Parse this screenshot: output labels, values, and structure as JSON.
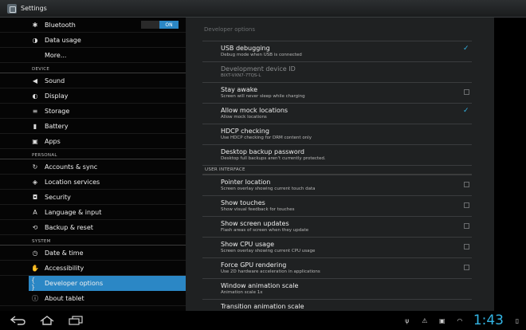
{
  "window": {
    "title": "Settings"
  },
  "left": {
    "bluetooth": {
      "label": "Bluetooth",
      "toggle": "ON"
    },
    "data_usage": "Data usage",
    "more": "More...",
    "device_header": "DEVICE",
    "sound": "Sound",
    "display": "Display",
    "storage": "Storage",
    "battery": "Battery",
    "apps": "Apps",
    "personal_header": "PERSONAL",
    "accounts": "Accounts & sync",
    "location": "Location services",
    "security": "Security",
    "language": "Language & input",
    "backup": "Backup & reset",
    "system_header": "SYSTEM",
    "datetime": "Date & time",
    "accessibility": "Accessibility",
    "developer": "Developer options",
    "about": "About tablet"
  },
  "right": {
    "header": "Developer options",
    "settings": [
      {
        "title": "USB debugging",
        "summary": "Debug mode when USB is connected",
        "checked": true
      },
      {
        "title": "Development device ID",
        "summary": "BIXT-VXN7-7TQS-L",
        "disabled": true
      },
      {
        "title": "Stay awake",
        "summary": "Screen will never sleep while charging",
        "checked": false
      },
      {
        "title": "Allow mock locations",
        "summary": "Allow mock locations",
        "checked": true
      },
      {
        "title": "HDCP checking",
        "summary": "Use HDCP checking for DRM content only"
      },
      {
        "title": "Desktop backup password",
        "summary": "Desktop full backups aren't currently protected."
      }
    ],
    "ui_header": "USER INTERFACE",
    "ui_settings": [
      {
        "title": "Pointer location",
        "summary": "Screen overlay showing current touch data",
        "checked": false
      },
      {
        "title": "Show touches",
        "summary": "Show visual feedback for touches",
        "checked": false
      },
      {
        "title": "Show screen updates",
        "summary": "Flash areas of screen when they update",
        "checked": false
      },
      {
        "title": "Show CPU usage",
        "summary": "Screen overlay showing current CPU usage",
        "checked": false
      },
      {
        "title": "Force GPU rendering",
        "summary": "Use 2D hardware acceleration in applications",
        "checked": false
      },
      {
        "title": "Window animation scale",
        "summary": "Animation scale 1x"
      },
      {
        "title": "Transition animation scale",
        "summary": ""
      }
    ]
  },
  "statusbar": {
    "time": "1:43"
  },
  "colors": {
    "accent": "#2b87c5",
    "check": "#33b5e5",
    "clock": "#33b5e5"
  }
}
